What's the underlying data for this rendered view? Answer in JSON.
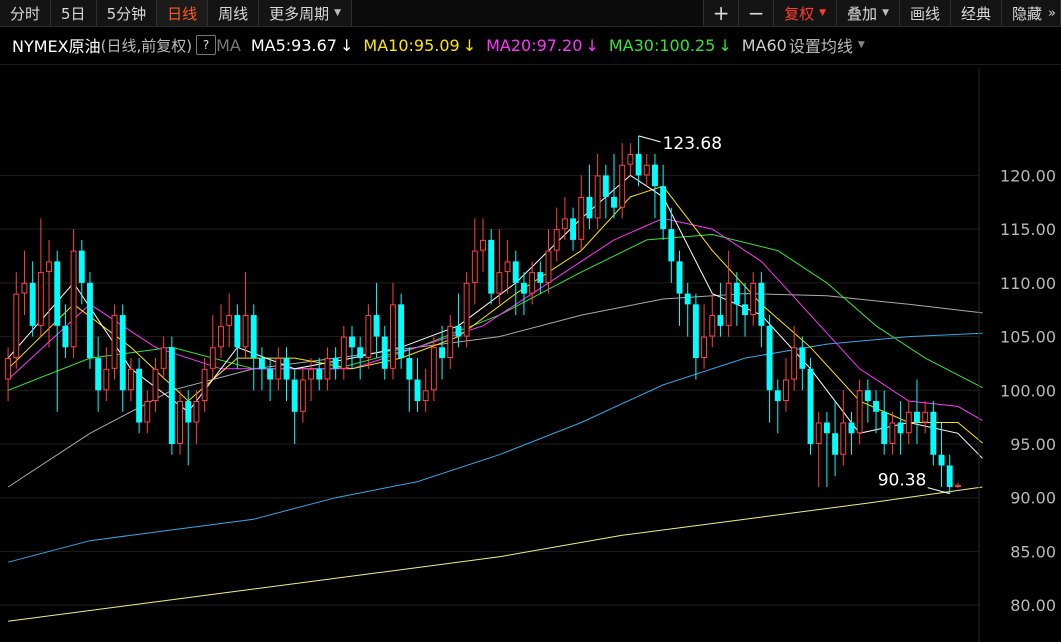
{
  "toolbar": {
    "tabs": [
      {
        "label": "分时"
      },
      {
        "label": "5日"
      },
      {
        "label": "5分钟"
      },
      {
        "label": "日线",
        "active": true
      },
      {
        "label": "周线"
      },
      {
        "label": "更多周期"
      }
    ],
    "zoom_in": "+",
    "zoom_out": "−",
    "fuquan": "复权",
    "diejia": "叠加",
    "huaxian": "画线",
    "jingdian": "经典",
    "yincang": "隐藏",
    "more": "»"
  },
  "legend": {
    "instrument": "NYMEX原油",
    "mode": "(日线,前复权)",
    "help": "?",
    "ma_label": "MA",
    "ma5": "MA5:93.67",
    "ma10": "MA10:95.09",
    "ma20": "MA20:97.20",
    "ma30": "MA30:100.25",
    "ma60": "MA60",
    "setting": "设置均线",
    "colors": {
      "ma5": "#ffffff",
      "ma10": "#ffe600",
      "ma20": "#ff35ff",
      "ma30": "#33e633",
      "ma60": "#cccccc"
    }
  },
  "annotations": {
    "high": "123.68",
    "low": "90.38"
  },
  "chart_data": {
    "type": "candlestick",
    "ylim": [
      77.5,
      130
    ],
    "y_ticks": [
      "120.00",
      "115.00",
      "110.00",
      "105.00",
      "100.00",
      "95.00",
      "90.00",
      "85.00",
      "80.00"
    ],
    "y_tick_values": [
      120,
      115,
      110,
      105,
      100,
      95,
      90,
      85,
      80
    ],
    "up_color": "#ff4040",
    "down_color": "#00ffff",
    "candles": [
      [
        101,
        103,
        99,
        104
      ],
      [
        103,
        109,
        102,
        111
      ],
      [
        109,
        110,
        107,
        113
      ],
      [
        110,
        106,
        105,
        112
      ],
      [
        106,
        111,
        105,
        116
      ],
      [
        111,
        112,
        104,
        114
      ],
      [
        112,
        106,
        98,
        113
      ],
      [
        106,
        104,
        103,
        108
      ],
      [
        104,
        113,
        103,
        115
      ],
      [
        113,
        110,
        108,
        114
      ],
      [
        110,
        103,
        102,
        111
      ],
      [
        103,
        100,
        98,
        105
      ],
      [
        100,
        102,
        99,
        104
      ],
      [
        102,
        107,
        101,
        108
      ],
      [
        107,
        100,
        98,
        108
      ],
      [
        100,
        102,
        99,
        103
      ],
      [
        102,
        97,
        96,
        103
      ],
      [
        97,
        99,
        96,
        100
      ],
      [
        99,
        102,
        98,
        103
      ],
      [
        102,
        104,
        101,
        105
      ],
      [
        104,
        95,
        94,
        105
      ],
      [
        95,
        99,
        94,
        100
      ],
      [
        99,
        97,
        93,
        100
      ],
      [
        97,
        99,
        95,
        100
      ],
      [
        99,
        102,
        98,
        103
      ],
      [
        102,
        104,
        101,
        107
      ],
      [
        104,
        106,
        103,
        108
      ],
      [
        106,
        107,
        104,
        109
      ],
      [
        107,
        104,
        102,
        108
      ],
      [
        104,
        107,
        103,
        111
      ],
      [
        107,
        103,
        100,
        108
      ],
      [
        103,
        102,
        100,
        104
      ],
      [
        102,
        101,
        99,
        103
      ],
      [
        101,
        103,
        100,
        104
      ],
      [
        103,
        101,
        99,
        104
      ],
      [
        101,
        98,
        95,
        102
      ],
      [
        98,
        101,
        97,
        102
      ],
      [
        101,
        102,
        99,
        103
      ],
      [
        102,
        101,
        100,
        103
      ],
      [
        101,
        103,
        100,
        104
      ],
      [
        103,
        102,
        101,
        104
      ],
      [
        102,
        105,
        101,
        106
      ],
      [
        105,
        104,
        102,
        106
      ],
      [
        104,
        103,
        101,
        105
      ],
      [
        103,
        107,
        102,
        108
      ],
      [
        107,
        105,
        103,
        110
      ],
      [
        105,
        102,
        101,
        106
      ],
      [
        102,
        108,
        101,
        110
      ],
      [
        108,
        103,
        102,
        109
      ],
      [
        103,
        101,
        98,
        104
      ],
      [
        101,
        99,
        98,
        103
      ],
      [
        99,
        100,
        98,
        102
      ],
      [
        100,
        104,
        99,
        105
      ],
      [
        104,
        103,
        101,
        106
      ],
      [
        103,
        106,
        102,
        107
      ],
      [
        106,
        105,
        104,
        109
      ],
      [
        105,
        110,
        104,
        111
      ],
      [
        110,
        113,
        108,
        116
      ],
      [
        113,
        114,
        111,
        116
      ],
      [
        114,
        109,
        108,
        115
      ],
      [
        109,
        111,
        108,
        115
      ],
      [
        111,
        112,
        109,
        114
      ],
      [
        112,
        110,
        107,
        113
      ],
      [
        110,
        109,
        107,
        111
      ],
      [
        109,
        111,
        108,
        112
      ],
      [
        111,
        110,
        109,
        112
      ],
      [
        110,
        113,
        109,
        115
      ],
      [
        113,
        115,
        112,
        117
      ],
      [
        115,
        116,
        114,
        118
      ],
      [
        116,
        114,
        113,
        117
      ],
      [
        114,
        118,
        113,
        120
      ],
      [
        118,
        116,
        115,
        121
      ],
      [
        116,
        120,
        115,
        122
      ],
      [
        120,
        118,
        116,
        121
      ],
      [
        118,
        117,
        116,
        122
      ],
      [
        117,
        121,
        116,
        123
      ],
      [
        121,
        122,
        120,
        123
      ],
      [
        122,
        120,
        119,
        123.68
      ],
      [
        120,
        121,
        119,
        122
      ],
      [
        121,
        119,
        116,
        122
      ],
      [
        119,
        115,
        114,
        121
      ],
      [
        115,
        112,
        110,
        117
      ],
      [
        112,
        109,
        106,
        113
      ],
      [
        109,
        108,
        105,
        110
      ],
      [
        108,
        103,
        101,
        109
      ],
      [
        103,
        105,
        102,
        108
      ],
      [
        105,
        107,
        104,
        109
      ],
      [
        107,
        106,
        105,
        110
      ],
      [
        106,
        110,
        105,
        113
      ],
      [
        110,
        108,
        106,
        111
      ],
      [
        108,
        107,
        105,
        110
      ],
      [
        107,
        110,
        106,
        111
      ],
      [
        110,
        106,
        104,
        111
      ],
      [
        106,
        100,
        97,
        107
      ],
      [
        100,
        99,
        96,
        101
      ],
      [
        99,
        101,
        98,
        103
      ],
      [
        101,
        104,
        100,
        106
      ],
      [
        104,
        102,
        100,
        105
      ],
      [
        102,
        95,
        94,
        103
      ],
      [
        95,
        97,
        91,
        98
      ],
      [
        97,
        96,
        91,
        98
      ],
      [
        96,
        94,
        92,
        99
      ],
      [
        94,
        97,
        93,
        100
      ],
      [
        97,
        96,
        94,
        98
      ],
      [
        96,
        100,
        95,
        101
      ],
      [
        100,
        99,
        97,
        101
      ],
      [
        99,
        98,
        96,
        100
      ],
      [
        98,
        95,
        94,
        100
      ],
      [
        95,
        97,
        94,
        98
      ],
      [
        97,
        96,
        94,
        99
      ],
      [
        96,
        98,
        95,
        99
      ],
      [
        98,
        97,
        95,
        101
      ],
      [
        97,
        98,
        96,
        99
      ],
      [
        98,
        94,
        93,
        99
      ],
      [
        94,
        93,
        91,
        97
      ],
      [
        93,
        91,
        90.38,
        94
      ],
      [
        91,
        91.2,
        90.9,
        91.4
      ]
    ],
    "ma5": [
      [
        0,
        103
      ],
      [
        8,
        110
      ],
      [
        15,
        102
      ],
      [
        22,
        98
      ],
      [
        28,
        104
      ],
      [
        35,
        102
      ],
      [
        42,
        103
      ],
      [
        48,
        104
      ],
      [
        55,
        106
      ],
      [
        62,
        110
      ],
      [
        70,
        116
      ],
      [
        76,
        120
      ],
      [
        80,
        118
      ],
      [
        86,
        109
      ],
      [
        92,
        107
      ],
      [
        98,
        102
      ],
      [
        104,
        96
      ],
      [
        110,
        97
      ],
      [
        116,
        96
      ],
      [
        119,
        93.67
      ]
    ],
    "ma10": [
      [
        0,
        102
      ],
      [
        8,
        108
      ],
      [
        15,
        104
      ],
      [
        22,
        99
      ],
      [
        28,
        103
      ],
      [
        35,
        103
      ],
      [
        42,
        102
      ],
      [
        48,
        103
      ],
      [
        55,
        105
      ],
      [
        62,
        109
      ],
      [
        70,
        113
      ],
      [
        76,
        118
      ],
      [
        80,
        119
      ],
      [
        86,
        113
      ],
      [
        92,
        108
      ],
      [
        98,
        104
      ],
      [
        104,
        99
      ],
      [
        110,
        97
      ],
      [
        116,
        97
      ],
      [
        119,
        95.09
      ]
    ],
    "ma20": [
      [
        0,
        101
      ],
      [
        10,
        108
      ],
      [
        18,
        104
      ],
      [
        26,
        102
      ],
      [
        34,
        102
      ],
      [
        42,
        102
      ],
      [
        50,
        104
      ],
      [
        58,
        106
      ],
      [
        66,
        110
      ],
      [
        74,
        114
      ],
      [
        80,
        116
      ],
      [
        86,
        115
      ],
      [
        92,
        112
      ],
      [
        98,
        107
      ],
      [
        104,
        102
      ],
      [
        110,
        99
      ],
      [
        116,
        98.5
      ],
      [
        119,
        97.2
      ]
    ],
    "ma30": [
      [
        0,
        100
      ],
      [
        10,
        103
      ],
      [
        20,
        104
      ],
      [
        30,
        102
      ],
      [
        40,
        102
      ],
      [
        50,
        104
      ],
      [
        60,
        107
      ],
      [
        70,
        111
      ],
      [
        78,
        114
      ],
      [
        86,
        114.5
      ],
      [
        94,
        113
      ],
      [
        100,
        110
      ],
      [
        106,
        106
      ],
      [
        112,
        103
      ],
      [
        119,
        100.25
      ]
    ],
    "ma60": [
      [
        0,
        91
      ],
      [
        10,
        96
      ],
      [
        20,
        100
      ],
      [
        30,
        102
      ],
      [
        40,
        103
      ],
      [
        50,
        104
      ],
      [
        60,
        105
      ],
      [
        70,
        107
      ],
      [
        80,
        108.5
      ],
      [
        90,
        109
      ],
      [
        100,
        108.8
      ],
      [
        110,
        108
      ],
      [
        119,
        107.2
      ]
    ],
    "ma120": [
      [
        0,
        84
      ],
      [
        10,
        86
      ],
      [
        20,
        87
      ],
      [
        30,
        88
      ],
      [
        40,
        90
      ],
      [
        50,
        91.5
      ],
      [
        60,
        94
      ],
      [
        70,
        97
      ],
      [
        80,
        100.5
      ],
      [
        90,
        103
      ],
      [
        100,
        104.3
      ],
      [
        110,
        105
      ],
      [
        119,
        105.3
      ]
    ],
    "ma250": [
      [
        0,
        78.5
      ],
      [
        15,
        80
      ],
      [
        30,
        81.5
      ],
      [
        45,
        83
      ],
      [
        60,
        84.5
      ],
      [
        75,
        86.5
      ],
      [
        90,
        88
      ],
      [
        105,
        89.5
      ],
      [
        119,
        91
      ]
    ]
  }
}
